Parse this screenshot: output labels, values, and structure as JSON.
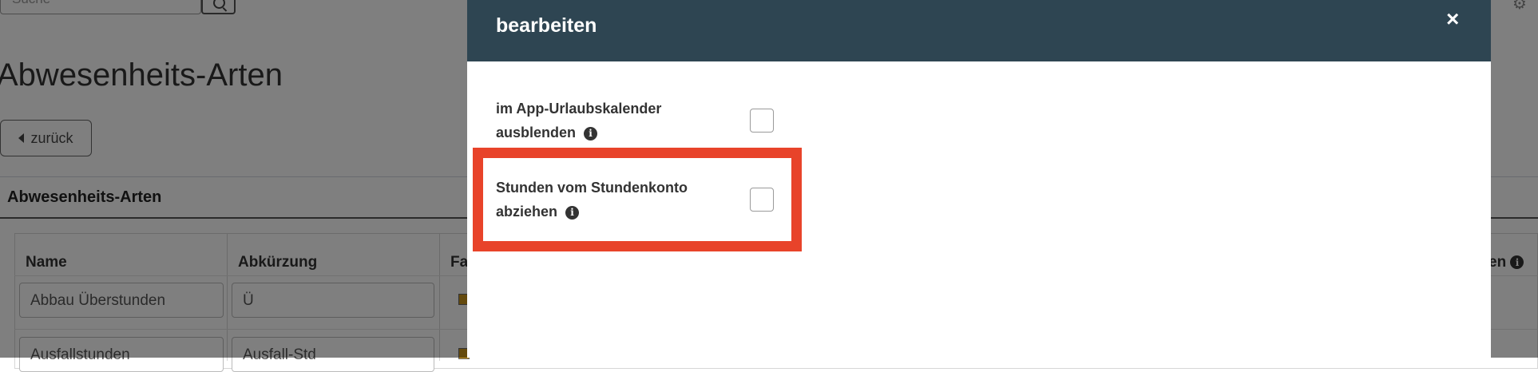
{
  "background": {
    "search_placeholder": "Suche",
    "page_title": "Abwesenheits-Arten",
    "back_button_label": "zurück",
    "section_header": "Abwesenheits-Arten",
    "table": {
      "columns": [
        "Name",
        "Abkürzung",
        "Fa"
      ],
      "right_column_partial": "en",
      "rows": [
        {
          "name": "Abbau Überstunden",
          "abbr": "Ü"
        },
        {
          "name": "Ausfallstunden",
          "abbr": "Ausfall-Std"
        }
      ]
    }
  },
  "modal": {
    "title": "bearbeiten",
    "close_icon": "×",
    "fields": [
      {
        "label_line1": "im App-Urlaubskalender",
        "label_line2": "ausblenden",
        "checked": false
      },
      {
        "label_line1": "Stunden vom Stundenkonto",
        "label_line2": "abziehen",
        "checked": false
      }
    ]
  },
  "colors": {
    "modal_header": "#2e4552",
    "highlight": "#e8432a",
    "swatch": "#c8941c"
  }
}
